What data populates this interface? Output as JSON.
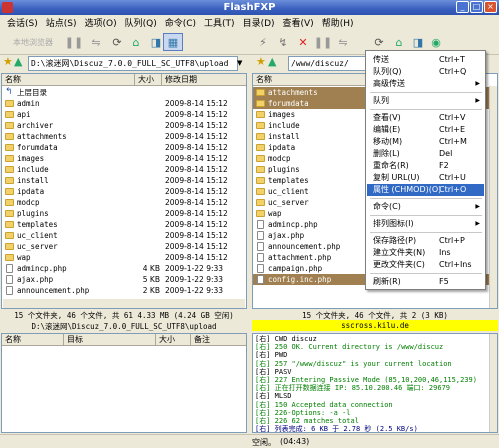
{
  "window": {
    "title": "FlashFXP"
  },
  "menubar": [
    "会话(S)",
    "站点(S)",
    "选项(O)",
    "队列(Q)",
    "命令(C)",
    "工具(T)",
    "目录(D)",
    "查看(V)",
    "帮助(H)"
  ],
  "toolbar": {
    "left_label": "本地浏览器"
  },
  "left": {
    "path": "D:\\滚迷网\\Discuz_7.0.0_FULL_SC_UTF8\\upload",
    "headers": {
      "name": "名称",
      "size": "大小",
      "date": "修改日期"
    },
    "up_label": "上层目录",
    "rows": [
      {
        "name": "admin",
        "size": "",
        "date": "2009-8-14 15:12",
        "type": "folder"
      },
      {
        "name": "api",
        "size": "",
        "date": "2009-8-14 15:12",
        "type": "folder"
      },
      {
        "name": "archiver",
        "size": "",
        "date": "2009-8-14 15:12",
        "type": "folder"
      },
      {
        "name": "attachments",
        "size": "",
        "date": "2009-8-14 15:12",
        "type": "folder"
      },
      {
        "name": "forumdata",
        "size": "",
        "date": "2009-8-14 15:12",
        "type": "folder"
      },
      {
        "name": "images",
        "size": "",
        "date": "2009-8-14 15:12",
        "type": "folder"
      },
      {
        "name": "include",
        "size": "",
        "date": "2009-8-14 15:12",
        "type": "folder"
      },
      {
        "name": "install",
        "size": "",
        "date": "2009-8-14 15:12",
        "type": "folder"
      },
      {
        "name": "ipdata",
        "size": "",
        "date": "2009-8-14 15:12",
        "type": "folder"
      },
      {
        "name": "modcp",
        "size": "",
        "date": "2009-8-14 15:12",
        "type": "folder"
      },
      {
        "name": "plugins",
        "size": "",
        "date": "2009-8-14 15:12",
        "type": "folder"
      },
      {
        "name": "templates",
        "size": "",
        "date": "2009-8-14 15:12",
        "type": "folder"
      },
      {
        "name": "uc_client",
        "size": "",
        "date": "2009-8-14 15:12",
        "type": "folder"
      },
      {
        "name": "uc_server",
        "size": "",
        "date": "2009-8-14 15:12",
        "type": "folder"
      },
      {
        "name": "wap",
        "size": "",
        "date": "2009-8-14 15:12",
        "type": "folder"
      },
      {
        "name": "admincp.php",
        "size": "4 KB",
        "date": "2009-1-22 9:33",
        "type": "file"
      },
      {
        "name": "ajax.php",
        "size": "5 KB",
        "date": "2009-1-22 9:33",
        "type": "file"
      },
      {
        "name": "announcement.php",
        "size": "2 KB",
        "date": "2009-1-22 9:33",
        "type": "file"
      }
    ],
    "status1": "15 个文件夹, 46 个文件, 共 61 4.33 MB (4.24 GB 空闲)",
    "status2": "D:\\滚迷网\\Discuz_7.0.0_FULL_SC_UTF8\\upload"
  },
  "right": {
    "path": "/www/discuz/",
    "headers": {
      "name": "名称"
    },
    "rows": [
      {
        "name": "attachments",
        "type": "folder",
        "sel": true
      },
      {
        "name": "forumdata",
        "type": "folder",
        "sel": true
      },
      {
        "name": "images",
        "type": "folder"
      },
      {
        "name": "include",
        "type": "folder"
      },
      {
        "name": "install",
        "type": "folder"
      },
      {
        "name": "ipdata",
        "type": "folder"
      },
      {
        "name": "modcp",
        "type": "folder"
      },
      {
        "name": "plugins",
        "type": "folder"
      },
      {
        "name": "templates",
        "type": "folder"
      },
      {
        "name": "uc_client",
        "type": "folder"
      },
      {
        "name": "uc_server",
        "type": "folder"
      },
      {
        "name": "wap",
        "type": "folder"
      },
      {
        "name": "admincp.php",
        "type": "file"
      },
      {
        "name": "ajax.php",
        "type": "file"
      },
      {
        "name": "announcement.php",
        "type": "file"
      },
      {
        "name": "attachment.php",
        "type": "file"
      },
      {
        "name": "campaign.php",
        "type": "file"
      },
      {
        "name": "config.inc.php",
        "type": "file",
        "sel": true
      }
    ],
    "status1": "15 个文件夹, 46 个文件, 共 2 (3 KB)",
    "status2": "sscross.kilu.de"
  },
  "context_menu": [
    {
      "label": "传送",
      "shortcut": "Ctrl+T"
    },
    {
      "label": "队列(Q)",
      "shortcut": "Ctrl+Q"
    },
    {
      "label": "高级传送",
      "shortcut": "",
      "arrow": true
    },
    {
      "sep": true
    },
    {
      "label": "队列",
      "shortcut": "",
      "arrow": true
    },
    {
      "sep": true
    },
    {
      "label": "查看(V)",
      "shortcut": "Ctrl+V"
    },
    {
      "label": "编辑(E)",
      "shortcut": "Ctrl+E"
    },
    {
      "label": "移动(M)",
      "shortcut": "Ctrl+M"
    },
    {
      "label": "删除(L)",
      "shortcut": "Del"
    },
    {
      "label": "重命名(R)",
      "shortcut": "F2"
    },
    {
      "label": "复制 URL(U)",
      "shortcut": "Ctrl+U"
    },
    {
      "label": "属性 (CHMOD)(O)",
      "shortcut": "Ctrl+O",
      "hl": true
    },
    {
      "sep": true
    },
    {
      "label": "命令(C)",
      "shortcut": "",
      "arrow": true
    },
    {
      "sep": true
    },
    {
      "label": "排列图标(I)",
      "shortcut": "",
      "arrow": true
    },
    {
      "sep": true
    },
    {
      "label": "保存路径(P)",
      "shortcut": "Ctrl+P"
    },
    {
      "label": "建立文件夹(N)",
      "shortcut": "Ins"
    },
    {
      "label": "更改文件夹(C)",
      "shortcut": "Ctrl+Ins"
    },
    {
      "sep": true
    },
    {
      "label": "刷新(R)",
      "shortcut": "F5"
    }
  ],
  "queue": {
    "headers": {
      "name": "名称",
      "target": "目标",
      "size": "大小",
      "note": "备注"
    }
  },
  "log": [
    {
      "tag": "[右]",
      "text": "CWD discuz",
      "color": "#000"
    },
    {
      "tag": "[右]",
      "text": "250 OK. Current directory is /www/discuz",
      "color": "#008000"
    },
    {
      "tag": "[右]",
      "text": "PWD",
      "color": "#000"
    },
    {
      "tag": "[右]",
      "text": "257 \"/www/discuz\" is your current location",
      "color": "#008000"
    },
    {
      "tag": "[右]",
      "text": "PASV",
      "color": "#000"
    },
    {
      "tag": "[右]",
      "text": "227 Entering Passive Mode (85,10,200,46,115,239)",
      "color": "#008000"
    },
    {
      "tag": "[右]",
      "text": "正在打开数据连接 IP: 85.10.200.46 端口: 29679",
      "color": "#008000"
    },
    {
      "tag": "[右]",
      "text": "MLSD",
      "color": "#000"
    },
    {
      "tag": "[右]",
      "text": "150 Accepted data connection",
      "color": "#008000"
    },
    {
      "tag": "[右]",
      "text": "226-Options: -a -l",
      "color": "#008000"
    },
    {
      "tag": "[右]",
      "text": "226 62 matches total",
      "color": "#008000"
    },
    {
      "tag": "[右]",
      "text": "列表完成: 6 KB 于 2.78 秒 (2.5 KB/s)",
      "color": "#000080"
    }
  ],
  "statusbar": {
    "left": "空闲。",
    "time": "(04:43)"
  }
}
